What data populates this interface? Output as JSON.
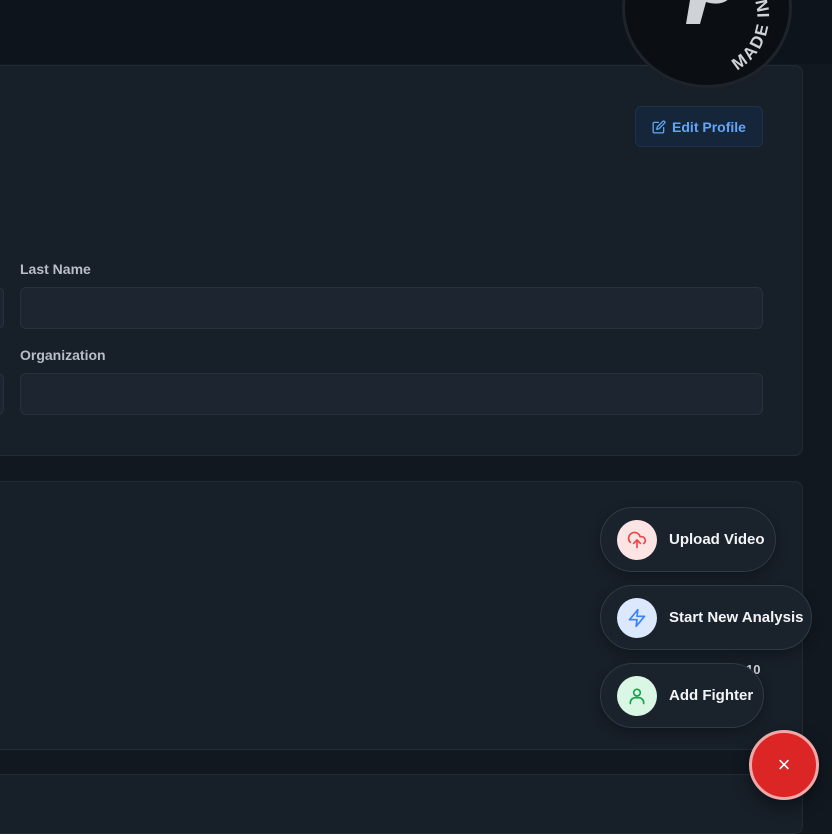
{
  "profile": {
    "edit_label": "Edit Profile",
    "last_name_label": "Last Name",
    "last_name_value": "",
    "organization_label": "Organization",
    "organization_value": ""
  },
  "badge": {
    "text": "MADE IN BOLT.NEW P"
  },
  "quick_actions": {
    "items": [
      {
        "label": "Upload Video",
        "icon": "upload-cloud-icon",
        "color": "#ef4444",
        "bg": "#fde4e4"
      },
      {
        "label": "Start New Analysis",
        "icon": "lightning-bolt-icon",
        "color": "#3b82f6",
        "bg": "#dbe8fd"
      },
      {
        "label": "Add Fighter",
        "icon": "user-icon",
        "color": "#16a34a",
        "bg": "#d9f7e4"
      }
    ],
    "close_symbol": "×"
  },
  "stats": {
    "partial_text": "10"
  },
  "colors": {
    "accent": "#60a5fa",
    "close": "#dc2626"
  }
}
